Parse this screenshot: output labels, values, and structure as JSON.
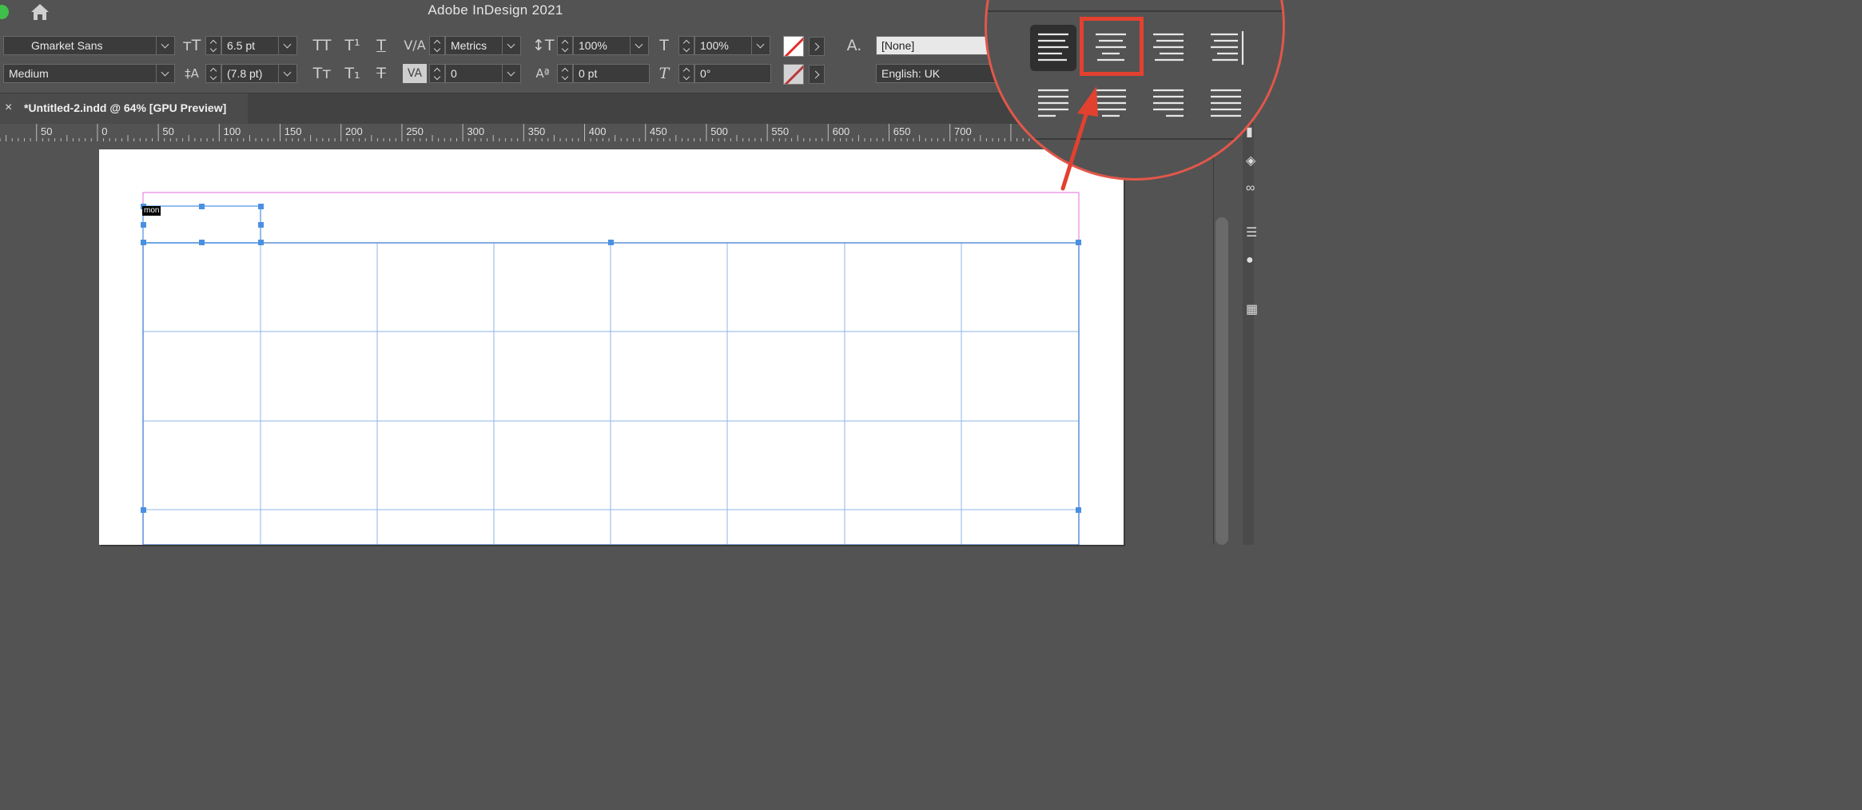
{
  "window": {
    "title": "Adobe InDesign 2021"
  },
  "control_panel": {
    "font_family": "Gmarket Sans",
    "font_style": "Medium",
    "font_size": "6.5 pt",
    "leading": "(7.8 pt)",
    "kerning": "Metrics",
    "tracking": "0",
    "vertical_scale": "100%",
    "horizontal_scale": "100%",
    "baseline_shift": "0 pt",
    "skew": "0°",
    "character_style": "[None]",
    "language": "English: UK"
  },
  "document_tab": {
    "label": "*Untitled-2.indd @ 64% [GPU Preview]",
    "close": "×"
  },
  "ruler": {
    "labels": [
      "50",
      "0",
      "50",
      "100",
      "150",
      "200",
      "250",
      "300",
      "350",
      "400",
      "450",
      "500",
      "550",
      "600",
      "650",
      "700"
    ]
  },
  "canvas": {
    "selected_text": "mon"
  },
  "highlight": {
    "box_color": "#e2412f",
    "arrow_color": "#e2412f"
  }
}
